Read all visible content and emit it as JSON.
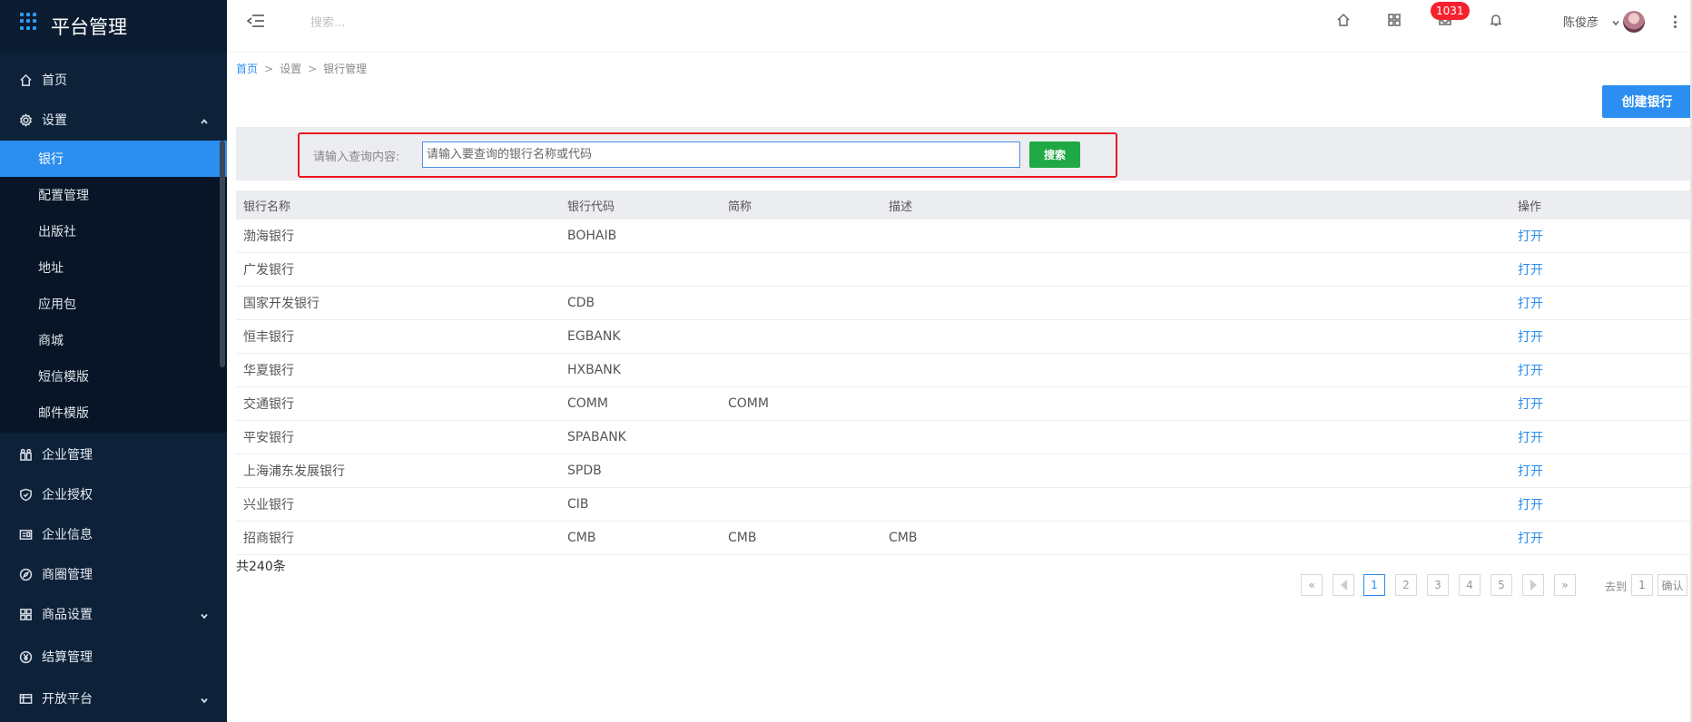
{
  "app": {
    "title": "平台管理"
  },
  "header": {
    "search_placeholder": "搜索...",
    "badge": "1031",
    "user_name": "陈俊彦"
  },
  "sidebar": {
    "items": [
      {
        "label": "首页",
        "icon": "home-icon"
      },
      {
        "label": "设置",
        "icon": "gear-icon",
        "expanded": true
      },
      {
        "label": "企业管理",
        "icon": "enterprise-icon"
      },
      {
        "label": "企业授权",
        "icon": "shield-check-icon"
      },
      {
        "label": "企业信息",
        "icon": "id-card-icon"
      },
      {
        "label": "商圈管理",
        "icon": "compass-icon"
      },
      {
        "label": "商品设置",
        "icon": "grid-icon",
        "collapsible": true
      },
      {
        "label": "结算管理",
        "icon": "yen-circle-icon"
      },
      {
        "label": "开放平台",
        "icon": "list-icon",
        "collapsible": true
      }
    ],
    "sub_items": [
      "银行",
      "配置管理",
      "出版社",
      "地址",
      "应用包",
      "商城",
      "短信模版",
      "邮件模版"
    ],
    "active_sub": "银行"
  },
  "breadcrumb": {
    "home": "首页",
    "sep": ">",
    "level1": "设置",
    "current": "银行管理"
  },
  "create_button": "创建银行",
  "search": {
    "label": "请输入查询内容:",
    "placeholder": "请输入要查询的银行名称或代码",
    "button": "搜索"
  },
  "table": {
    "headers": {
      "name": "银行名称",
      "code": "银行代码",
      "short": "简称",
      "desc": "描述",
      "op": "操作"
    },
    "rows": [
      {
        "name": "渤海银行",
        "code": "BOHAIB",
        "short": "",
        "desc": "",
        "op": "打开"
      },
      {
        "name": "广发银行",
        "code": "",
        "short": "",
        "desc": "",
        "op": "打开"
      },
      {
        "name": "国家开发银行",
        "code": "CDB",
        "short": "",
        "desc": "",
        "op": "打开"
      },
      {
        "name": "恒丰银行",
        "code": "EGBANK",
        "short": "",
        "desc": "",
        "op": "打开"
      },
      {
        "name": "华夏银行",
        "code": "HXBANK",
        "short": "",
        "desc": "",
        "op": "打开"
      },
      {
        "name": "交通银行",
        "code": "COMM",
        "short": "COMM",
        "desc": "",
        "op": "打开"
      },
      {
        "name": "平安银行",
        "code": "SPABANK",
        "short": "",
        "desc": "",
        "op": "打开"
      },
      {
        "name": "上海浦东发展银行",
        "code": "SPDB",
        "short": "",
        "desc": "",
        "op": "打开"
      },
      {
        "name": "兴业银行",
        "code": "CIB",
        "short": "",
        "desc": "",
        "op": "打开"
      },
      {
        "name": "招商银行",
        "code": "CMB",
        "short": "CMB",
        "desc": "CMB",
        "op": "打开"
      }
    ]
  },
  "total": "共240条",
  "pagination": {
    "first": "«",
    "last": "»",
    "pages": [
      "1",
      "2",
      "3",
      "4",
      "5"
    ],
    "current": "1",
    "goto_label": "去到",
    "goto_value": "1",
    "confirm": "确认"
  },
  "colors": {
    "sidebar_bg": "#0d2139",
    "accent": "#2b8ef0",
    "search_button": "#1fa843",
    "badge": "#f5222d",
    "highlight_border": "#e8171f"
  }
}
